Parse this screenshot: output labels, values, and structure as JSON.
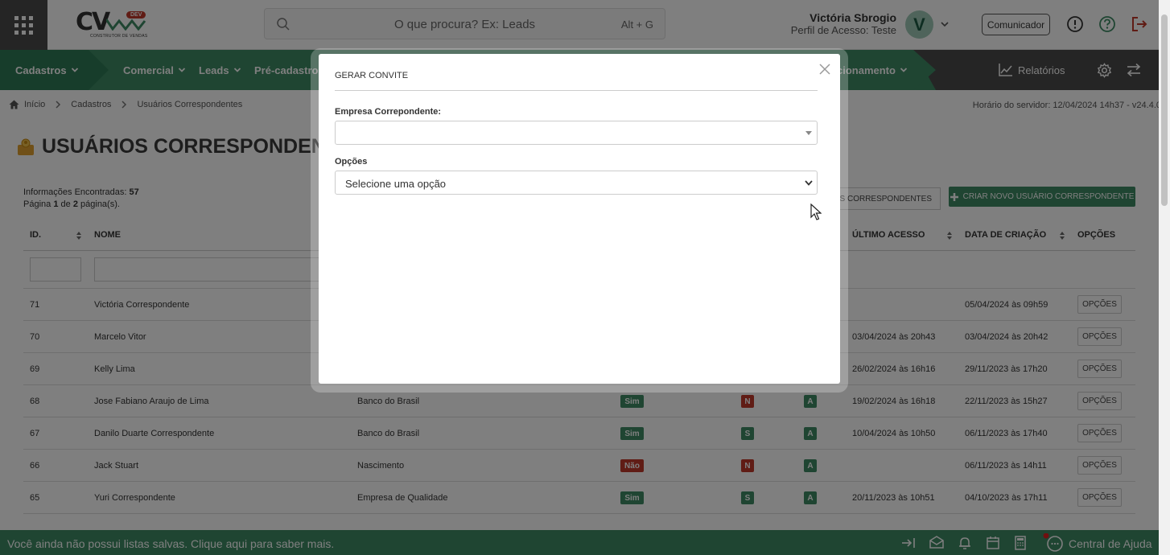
{
  "header": {
    "logo_text": "CV",
    "logo_badge": "DEV",
    "logo_subtitle": "CONSTRUTOR DE VENDAS",
    "search_placeholder": "O que procura? Ex: Leads",
    "search_shortcut": "Alt + G",
    "user_name": "Victória Sbrogio",
    "user_profile": "Perfil de Acesso: Teste",
    "avatar_initial": "V",
    "communicator_label": "Comunicador"
  },
  "nav": {
    "items": [
      "Cadastros",
      "Comercial",
      "Leads",
      "Pré-cadastros",
      "cionamento"
    ],
    "reports": "Relatórios"
  },
  "breadcrumb": {
    "items": [
      "Início",
      "Cadastros",
      "Usuários Correspondentes"
    ],
    "server_time": "Horário do servidor: 12/04/2024 14h37 - v24.4.0"
  },
  "page": {
    "title": "USUÁRIOS CORRESPONDEN",
    "info_label": "Informações Encontradas:",
    "info_count": "57",
    "page_word": "Página",
    "page_current": "1",
    "page_of": "de",
    "page_total": "2",
    "page_suffix": "página(s).",
    "export_button": "IOS CORRESPONDENTES",
    "create_button": "CRIAR NOVO USUÁRIO CORRESPONDENTE"
  },
  "table": {
    "headers": {
      "id": "ID.",
      "name": "NOME",
      "last_access": "ÚLTIMO ACESSO",
      "created": "DATA DE CRIAÇÃO",
      "options": "OPÇÕES"
    },
    "option_button": "OPÇÕES",
    "rows": [
      {
        "id": "71",
        "name": "Victória Correspondente",
        "company": "",
        "active": "",
        "n": "",
        "a": "",
        "last": "",
        "created": "05/04/2024 às 09h59"
      },
      {
        "id": "70",
        "name": "Marcelo Vitor",
        "company": "",
        "active": "",
        "n": "",
        "a": "",
        "last": "03/04/2024 às 20h43",
        "created": "03/04/2024 às 20h42"
      },
      {
        "id": "69",
        "name": "Kelly Lima",
        "company": "",
        "active": "",
        "n": "",
        "a": "",
        "last": "26/02/2024 às 16h16",
        "created": "29/11/2023 às 17h20"
      },
      {
        "id": "68",
        "name": "Jose Fabiano Araujo de Lima",
        "company": "Banco do Brasil",
        "active": "Sim",
        "n": "N",
        "a": "A",
        "last": "19/02/2024 às 16h18",
        "created": "22/11/2023 às 15h27"
      },
      {
        "id": "67",
        "name": "Danilo Duarte Correspondente",
        "company": "Banco do Brasil",
        "active": "Sim",
        "n": "S",
        "a": "A",
        "last": "10/04/2024 às 10h50",
        "created": "06/11/2023 às 17h40"
      },
      {
        "id": "66",
        "name": "Jack Stuart",
        "company": "Nascimento",
        "active": "Não",
        "n": "N",
        "a": "A",
        "last": "",
        "created": "06/11/2023 às 14h11"
      },
      {
        "id": "65",
        "name": "Yuri Correspondente",
        "company": "Empresa de Qualidade",
        "active": "Sim",
        "n": "S",
        "a": "A",
        "last": "20/11/2023 às 10h51",
        "created": "04/10/2023 às 17h11"
      }
    ]
  },
  "footer": {
    "message": "Você ainda não possui listas salvas. Clique aqui para saber mais.",
    "help": "Central de Ajuda"
  },
  "modal": {
    "title": "GERAR CONVITE",
    "company_label": "Empresa Correpondente:",
    "company_value": "",
    "options_label": "Opções",
    "options_value": "Selecione uma opção"
  },
  "colors": {
    "brand_green": "#3f8a65",
    "dark_green": "#2f7a56",
    "danger_red": "#c0392b",
    "dark_gray": "#4a4a4a"
  }
}
